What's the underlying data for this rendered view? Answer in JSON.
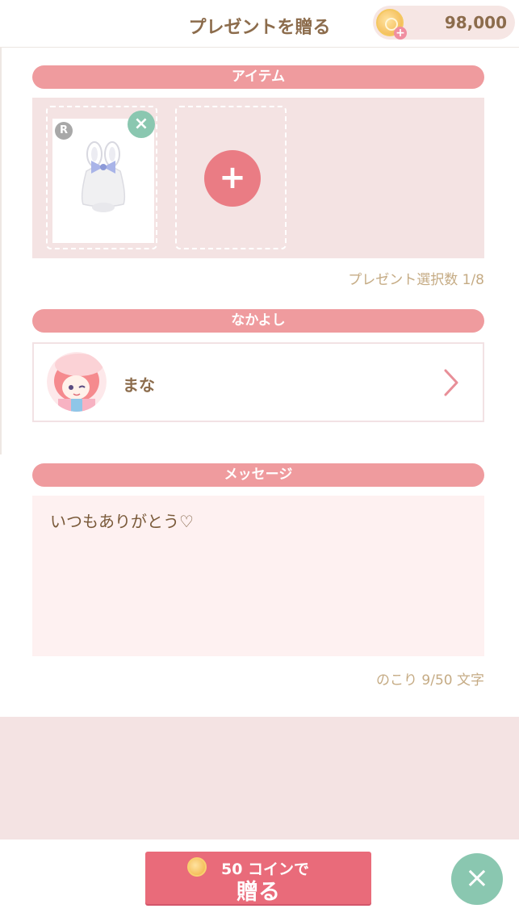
{
  "header": {
    "title": "プレゼントを贈る",
    "coin_amount": "98,000",
    "coin_add_symbol": "+"
  },
  "items_section": {
    "title": "アイテム",
    "rarity_badge": "R",
    "remove_symbol": "×",
    "add_symbol": "+",
    "selection_count": "プレゼント選択数 1/8"
  },
  "friend_section": {
    "title": "なかよし",
    "friend_name": "まな"
  },
  "message_section": {
    "title": "メッセージ",
    "message_text": "いつもありがとう♡",
    "remaining": "のこり 9/50 文字"
  },
  "footer": {
    "send_subtitle": "50 コインで",
    "send_label": "贈る",
    "close_symbol": "×"
  },
  "colors": {
    "accent_pink": "#ef9b9e",
    "button_pink": "#e96b7a",
    "mint": "#8ac7b0",
    "text_brown": "#8c6c4c"
  }
}
